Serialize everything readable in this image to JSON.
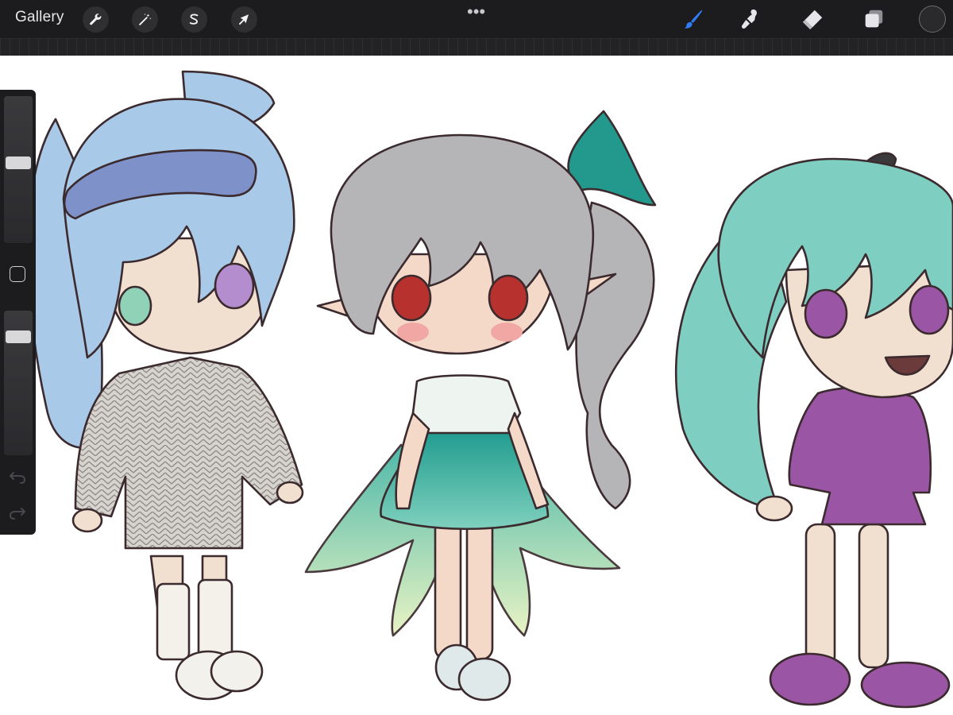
{
  "app": {
    "gallery_label": "Gallery"
  },
  "toolbar": {
    "left_tools": [
      {
        "name": "actions",
        "icon": "wrench-icon"
      },
      {
        "name": "adjustments",
        "icon": "magic-wand-icon"
      },
      {
        "name": "selection",
        "icon": "selection-s-icon"
      },
      {
        "name": "transform",
        "icon": "arrow-cursor-icon"
      }
    ],
    "more_icon": "ellipsis-icon",
    "right_tools": [
      {
        "name": "brush",
        "icon": "brush-icon",
        "active": true
      },
      {
        "name": "smudge",
        "icon": "smudge-icon",
        "active": false
      },
      {
        "name": "eraser",
        "icon": "eraser-icon",
        "active": false
      },
      {
        "name": "layers",
        "icon": "layers-icon",
        "active": false
      }
    ],
    "color": "#2a2a2c",
    "accent": "#2f7cf6"
  },
  "sidebar": {
    "brush_size_level": 0.55,
    "opacity_level": 0.85,
    "modify_icon": "square-icon",
    "undo_icon": "undo-arrow-icon",
    "redo_icon": "redo-arrow-icon"
  }
}
